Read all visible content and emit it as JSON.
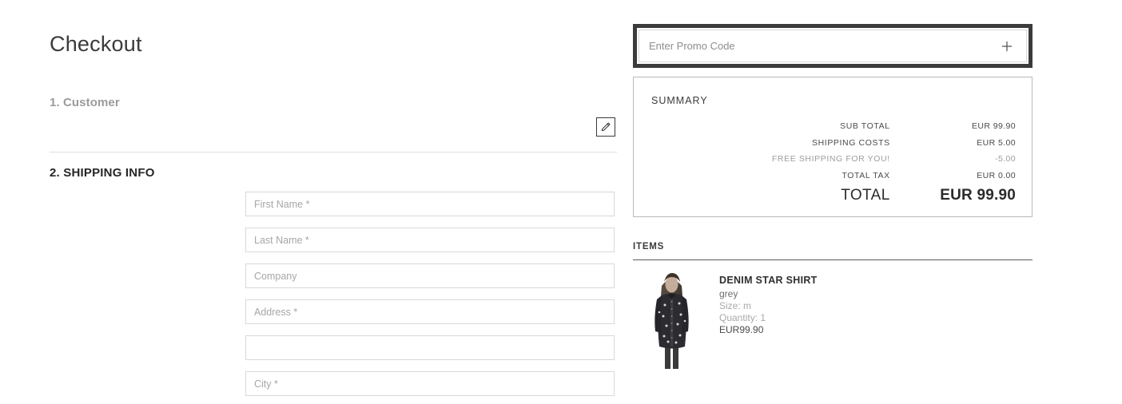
{
  "page": {
    "title": "Checkout"
  },
  "steps": {
    "customer": "1. Customer",
    "shipping": "2. SHIPPING INFO",
    "edit_icon": "pencil-icon"
  },
  "shipping_form": {
    "fields": [
      {
        "name": "first-name",
        "placeholder": "First Name *",
        "value": ""
      },
      {
        "name": "last-name",
        "placeholder": "Last Name *",
        "value": ""
      },
      {
        "name": "company",
        "placeholder": "Company",
        "value": ""
      },
      {
        "name": "address",
        "placeholder": "Address *",
        "value": ""
      },
      {
        "name": "address-line-2",
        "placeholder": "",
        "value": ""
      },
      {
        "name": "city",
        "placeholder": "City *",
        "value": ""
      }
    ]
  },
  "promo": {
    "placeholder": "Enter Promo Code",
    "value": "",
    "add_icon": "plus-icon",
    "focus_color": "#3b3b3b"
  },
  "summary": {
    "title": "SUMMARY",
    "rows": [
      {
        "label": "SUB TOTAL",
        "value": "EUR 99.90",
        "muted": false
      },
      {
        "label": "SHIPPING COSTS",
        "value": "EUR 5.00",
        "muted": false
      },
      {
        "label": "FREE SHIPPING FOR YOU!",
        "value": "-5.00",
        "muted": true
      },
      {
        "label": "TOTAL TAX",
        "value": "EUR 0.00",
        "muted": false
      }
    ],
    "total": {
      "label": "TOTAL",
      "value": "EUR 99.90"
    }
  },
  "items": {
    "title": "ITEMS",
    "list": [
      {
        "name": "DENIM STAR SHIRT",
        "color": "grey",
        "size": "Size: m",
        "quantity": "Quantity: 1",
        "price": "EUR99.90",
        "thumb_alt": "product-thumbnail-denim-star-shirt"
      }
    ]
  }
}
